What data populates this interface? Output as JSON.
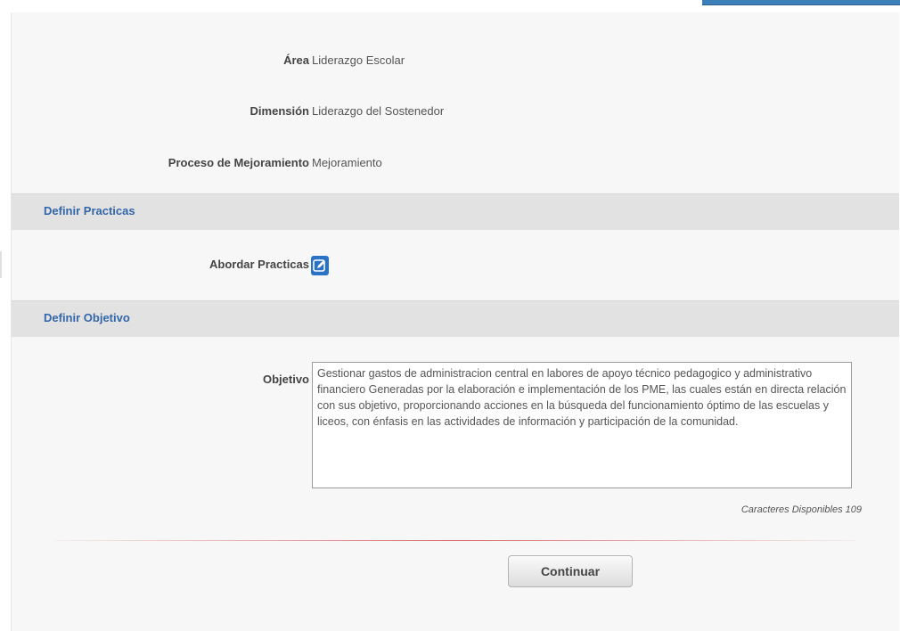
{
  "info": {
    "area_label": "Área",
    "area_value": "Liderazgo Escolar",
    "dimension_label": "Dimensión",
    "dimension_value": "Liderazgo del Sostenedor",
    "proceso_label": "Proceso de Mejoramiento",
    "proceso_value": "Mejoramiento"
  },
  "practicas_section": {
    "title": "Definir Practicas",
    "abordar_label": "Abordar Practicas"
  },
  "objetivo_section": {
    "title": "Definir Objetivo",
    "objetivo_label": "Objetivo",
    "objetivo_text": "Gestionar gastos de administracion central en labores de apoyo técnico pedagogico y administrativo financiero Generadas por la elaboración e implementación de los PME, las cuales están en directa relación con sus objetivo, proporcionando acciones en la búsqueda del funcionamiento óptimo de las escuelas y liceos, con énfasis en las actividades de información y participación de la comunidad.",
    "chars_available": "Caracteres Disponibles 109"
  },
  "actions": {
    "continuar_label": "Continuar"
  },
  "colors": {
    "accent": "#3366aa",
    "section_bg": "#e2e2e2",
    "edit_button": "#2a72c6"
  },
  "icons": {
    "edit": "edit-icon"
  }
}
